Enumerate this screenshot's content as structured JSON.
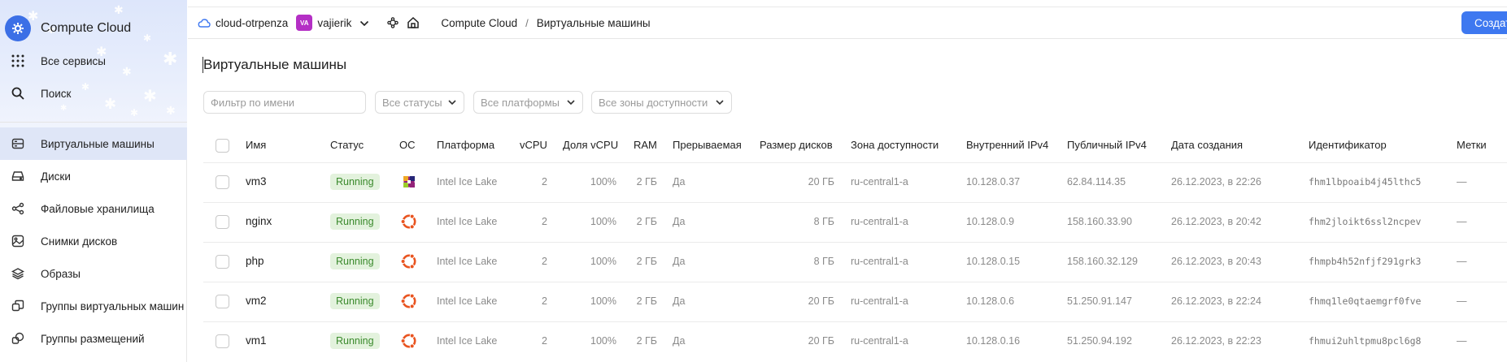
{
  "sidebar": {
    "brand": "Compute Cloud",
    "items": [
      {
        "label": "Все сервисы",
        "icon": "grid-icon"
      },
      {
        "label": "Поиск",
        "icon": "search-icon"
      },
      {
        "label": "Виртуальные машины",
        "icon": "vm-icon",
        "active": true
      },
      {
        "label": "Диски",
        "icon": "disk-icon"
      },
      {
        "label": "Файловые хранилища",
        "icon": "share-icon"
      },
      {
        "label": "Снимки дисков",
        "icon": "image-icon"
      },
      {
        "label": "Образы",
        "icon": "layers-icon"
      },
      {
        "label": "Группы виртуальных машин",
        "icon": "group-icon"
      },
      {
        "label": "Группы размещений",
        "icon": "placement-icon"
      }
    ]
  },
  "header": {
    "cloud": "cloud-otrpenza",
    "avatar": "VA",
    "user": "vajierik",
    "breadcrumb_root": "Compute Cloud",
    "breadcrumb_sep": "/",
    "breadcrumb_current": "Виртуальные машины",
    "create_label": "Создать"
  },
  "main": {
    "title": "Виртуальные машины",
    "filters": {
      "name_placeholder": "Фильтр по имени",
      "status": "Все статусы",
      "platform": "Все платформы",
      "zone": "Все зоны доступности"
    }
  },
  "table": {
    "columns": [
      "Имя",
      "Статус",
      "ОС",
      "Платформа",
      "vCPU",
      "Доля vCPU",
      "RAM",
      "Прерываемая",
      "Размер дисков",
      "Зона доступности",
      "Внутренний IPv4",
      "Публичный IPv4",
      "Дата создания",
      "Идентификатор",
      "Метки"
    ],
    "rows": [
      {
        "name": "vm3",
        "status": "Running",
        "os": "centos-icon",
        "platform": "Intel Ice Lake",
        "vcpu": "2",
        "share": "100%",
        "ram": "2 ГБ",
        "preempt": "Да",
        "disk": "20 ГБ",
        "zone": "ru-central1-a",
        "ip_int": "10.128.0.37",
        "ip_pub": "62.84.114.35",
        "date": "26.12.2023, в 22:26",
        "id": "fhm1lbpoaib4j45lthc5",
        "labels": "—"
      },
      {
        "name": "nginx",
        "status": "Running",
        "os": "ubuntu-icon",
        "platform": "Intel Ice Lake",
        "vcpu": "2",
        "share": "100%",
        "ram": "2 ГБ",
        "preempt": "Да",
        "disk": "8 ГБ",
        "zone": "ru-central1-a",
        "ip_int": "10.128.0.9",
        "ip_pub": "158.160.33.90",
        "date": "26.12.2023, в 20:42",
        "id": "fhm2jloikt6ssl2ncpev",
        "labels": "—"
      },
      {
        "name": "php",
        "status": "Running",
        "os": "ubuntu-icon",
        "platform": "Intel Ice Lake",
        "vcpu": "2",
        "share": "100%",
        "ram": "2 ГБ",
        "preempt": "Да",
        "disk": "8 ГБ",
        "zone": "ru-central1-a",
        "ip_int": "10.128.0.15",
        "ip_pub": "158.160.32.129",
        "date": "26.12.2023, в 20:43",
        "id": "fhmpb4h52nfjf291grk3",
        "labels": "—"
      },
      {
        "name": "vm2",
        "status": "Running",
        "os": "ubuntu-icon",
        "platform": "Intel Ice Lake",
        "vcpu": "2",
        "share": "100%",
        "ram": "2 ГБ",
        "preempt": "Да",
        "disk": "20 ГБ",
        "zone": "ru-central1-a",
        "ip_int": "10.128.0.6",
        "ip_pub": "51.250.91.147",
        "date": "26.12.2023, в 22:24",
        "id": "fhmq1le0qtaemgrf0fve",
        "labels": "—"
      },
      {
        "name": "vm1",
        "status": "Running",
        "os": "ubuntu-icon",
        "platform": "Intel Ice Lake",
        "vcpu": "2",
        "share": "100%",
        "ram": "2 ГБ",
        "preempt": "Да",
        "disk": "20 ГБ",
        "zone": "ru-central1-a",
        "ip_int": "10.128.0.16",
        "ip_pub": "51.250.94.192",
        "date": "26.12.2023, в 22:23",
        "id": "fhmui2uhltpmu8pcl6g8",
        "labels": "—"
      }
    ]
  },
  "colors": {
    "accent": "#3e78f0",
    "running_bg": "#e3f2dd",
    "running_fg": "#3a8a2c",
    "active_nav": "#dfe6f7"
  }
}
